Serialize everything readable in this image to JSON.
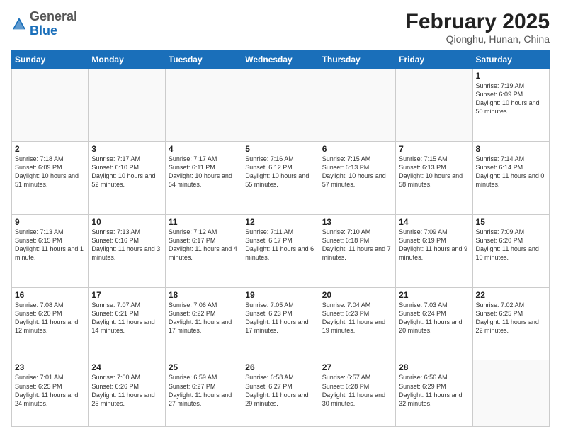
{
  "header": {
    "logo_general": "General",
    "logo_blue": "Blue",
    "title": "February 2025",
    "subtitle": "Qionghu, Hunan, China"
  },
  "weekdays": [
    "Sunday",
    "Monday",
    "Tuesday",
    "Wednesday",
    "Thursday",
    "Friday",
    "Saturday"
  ],
  "weeks": [
    [
      {
        "day": "",
        "info": ""
      },
      {
        "day": "",
        "info": ""
      },
      {
        "day": "",
        "info": ""
      },
      {
        "day": "",
        "info": ""
      },
      {
        "day": "",
        "info": ""
      },
      {
        "day": "",
        "info": ""
      },
      {
        "day": "1",
        "info": "Sunrise: 7:19 AM\nSunset: 6:09 PM\nDaylight: 10 hours\nand 50 minutes."
      }
    ],
    [
      {
        "day": "2",
        "info": "Sunrise: 7:18 AM\nSunset: 6:09 PM\nDaylight: 10 hours\nand 51 minutes."
      },
      {
        "day": "3",
        "info": "Sunrise: 7:17 AM\nSunset: 6:10 PM\nDaylight: 10 hours\nand 52 minutes."
      },
      {
        "day": "4",
        "info": "Sunrise: 7:17 AM\nSunset: 6:11 PM\nDaylight: 10 hours\nand 54 minutes."
      },
      {
        "day": "5",
        "info": "Sunrise: 7:16 AM\nSunset: 6:12 PM\nDaylight: 10 hours\nand 55 minutes."
      },
      {
        "day": "6",
        "info": "Sunrise: 7:15 AM\nSunset: 6:13 PM\nDaylight: 10 hours\nand 57 minutes."
      },
      {
        "day": "7",
        "info": "Sunrise: 7:15 AM\nSunset: 6:13 PM\nDaylight: 10 hours\nand 58 minutes."
      },
      {
        "day": "8",
        "info": "Sunrise: 7:14 AM\nSunset: 6:14 PM\nDaylight: 11 hours\nand 0 minutes."
      }
    ],
    [
      {
        "day": "9",
        "info": "Sunrise: 7:13 AM\nSunset: 6:15 PM\nDaylight: 11 hours\nand 1 minute."
      },
      {
        "day": "10",
        "info": "Sunrise: 7:13 AM\nSunset: 6:16 PM\nDaylight: 11 hours\nand 3 minutes."
      },
      {
        "day": "11",
        "info": "Sunrise: 7:12 AM\nSunset: 6:17 PM\nDaylight: 11 hours\nand 4 minutes."
      },
      {
        "day": "12",
        "info": "Sunrise: 7:11 AM\nSunset: 6:17 PM\nDaylight: 11 hours\nand 6 minutes."
      },
      {
        "day": "13",
        "info": "Sunrise: 7:10 AM\nSunset: 6:18 PM\nDaylight: 11 hours\nand 7 minutes."
      },
      {
        "day": "14",
        "info": "Sunrise: 7:09 AM\nSunset: 6:19 PM\nDaylight: 11 hours\nand 9 minutes."
      },
      {
        "day": "15",
        "info": "Sunrise: 7:09 AM\nSunset: 6:20 PM\nDaylight: 11 hours\nand 10 minutes."
      }
    ],
    [
      {
        "day": "16",
        "info": "Sunrise: 7:08 AM\nSunset: 6:20 PM\nDaylight: 11 hours\nand 12 minutes."
      },
      {
        "day": "17",
        "info": "Sunrise: 7:07 AM\nSunset: 6:21 PM\nDaylight: 11 hours\nand 14 minutes."
      },
      {
        "day": "18",
        "info": "Sunrise: 7:06 AM\nSunset: 6:22 PM\nDaylight: 11 hours\nand 17 minutes."
      },
      {
        "day": "19",
        "info": "Sunrise: 7:05 AM\nSunset: 6:23 PM\nDaylight: 11 hours\nand 17 minutes."
      },
      {
        "day": "20",
        "info": "Sunrise: 7:04 AM\nSunset: 6:23 PM\nDaylight: 11 hours\nand 19 minutes."
      },
      {
        "day": "21",
        "info": "Sunrise: 7:03 AM\nSunset: 6:24 PM\nDaylight: 11 hours\nand 20 minutes."
      },
      {
        "day": "22",
        "info": "Sunrise: 7:02 AM\nSunset: 6:25 PM\nDaylight: 11 hours\nand 22 minutes."
      }
    ],
    [
      {
        "day": "23",
        "info": "Sunrise: 7:01 AM\nSunset: 6:25 PM\nDaylight: 11 hours\nand 24 minutes."
      },
      {
        "day": "24",
        "info": "Sunrise: 7:00 AM\nSunset: 6:26 PM\nDaylight: 11 hours\nand 25 minutes."
      },
      {
        "day": "25",
        "info": "Sunrise: 6:59 AM\nSunset: 6:27 PM\nDaylight: 11 hours\nand 27 minutes."
      },
      {
        "day": "26",
        "info": "Sunrise: 6:58 AM\nSunset: 6:27 PM\nDaylight: 11 hours\nand 29 minutes."
      },
      {
        "day": "27",
        "info": "Sunrise: 6:57 AM\nSunset: 6:28 PM\nDaylight: 11 hours\nand 30 minutes."
      },
      {
        "day": "28",
        "info": "Sunrise: 6:56 AM\nSunset: 6:29 PM\nDaylight: 11 hours\nand 32 minutes."
      },
      {
        "day": "",
        "info": ""
      }
    ]
  ]
}
